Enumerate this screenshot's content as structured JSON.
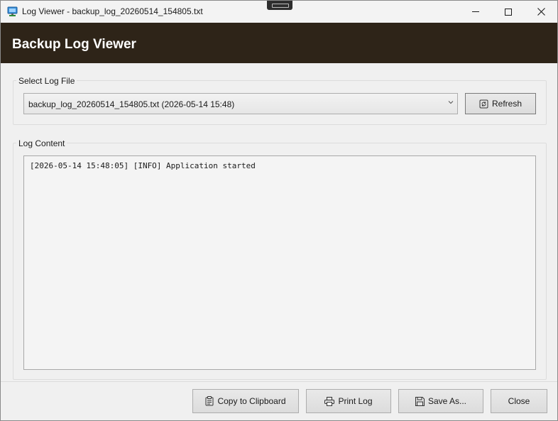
{
  "window": {
    "title": "Log Viewer - backup_log_20260514_154805.txt"
  },
  "header": {
    "title": "Backup Log Viewer"
  },
  "file_group": {
    "label": "Select Log File",
    "selected_file": "backup_log_20260514_154805.txt (2026-05-14 15:48)",
    "refresh_label": "Refresh"
  },
  "content_group": {
    "label": "Log Content",
    "lines": [
      "[2026-05-14 15:48:05] [INFO] Application started"
    ]
  },
  "footer": {
    "copy_label": "Copy to Clipboard",
    "print_label": "Print Log",
    "save_label": "Save As...",
    "close_label": "Close"
  },
  "colors": {
    "header_bg": "#2e2418",
    "header_text": "#ffffff",
    "window_bg": "#f0f0f0"
  },
  "icons": {
    "app": "monitor-network-icon",
    "refresh": "refresh-icon",
    "copy": "clipboard-icon",
    "print": "printer-icon",
    "save": "floppy-disk-icon"
  }
}
